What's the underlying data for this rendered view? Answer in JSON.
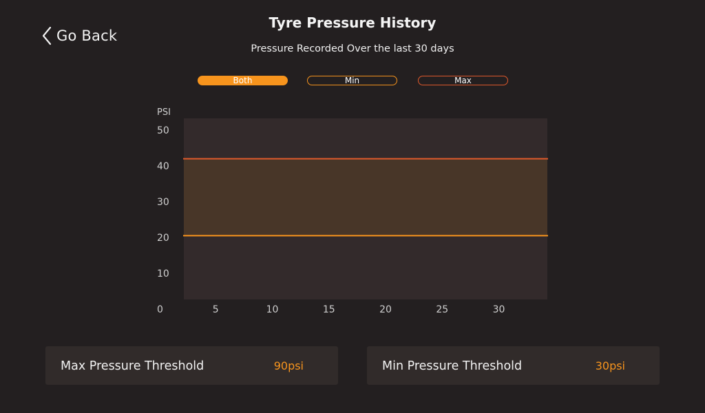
{
  "nav": {
    "back_label": "Go Back"
  },
  "header": {
    "title": "Tyre Pressure History",
    "subtitle": "Pressure Recorded Over the last 30 days"
  },
  "filters": [
    {
      "label": "Both",
      "selected": true
    },
    {
      "label": "Min",
      "selected": false
    },
    {
      "label": "Max",
      "selected": false
    }
  ],
  "colors": {
    "background": "#231f20",
    "plot_bg": "#332a2b",
    "band_fill": "#483628",
    "accent_orange": "#f7941d",
    "accent_red": "#e25a2c",
    "card_bg": "#312b2a"
  },
  "chart_data": {
    "type": "line",
    "ylabel": "PSI",
    "xlabel": "",
    "ylim": [
      0,
      50
    ],
    "xlim": [
      0,
      35
    ],
    "y_ticks": [
      0,
      10,
      20,
      30,
      40,
      50
    ],
    "x_ticks": [
      5,
      10,
      15,
      20,
      25,
      30
    ],
    "series": [
      {
        "x": [
          2,
          33
        ],
        "values": [
          42,
          42
        ],
        "color": "#e25a2c"
      },
      {
        "x": [
          2,
          33
        ],
        "values": [
          20.5,
          20.5
        ],
        "color": "#f7941d"
      }
    ],
    "grid": false
  },
  "thresholds": {
    "max": {
      "label": "Max Pressure Threshold",
      "value": "90psi"
    },
    "min": {
      "label": "Min Pressure Threshold",
      "value": "30psi"
    }
  }
}
